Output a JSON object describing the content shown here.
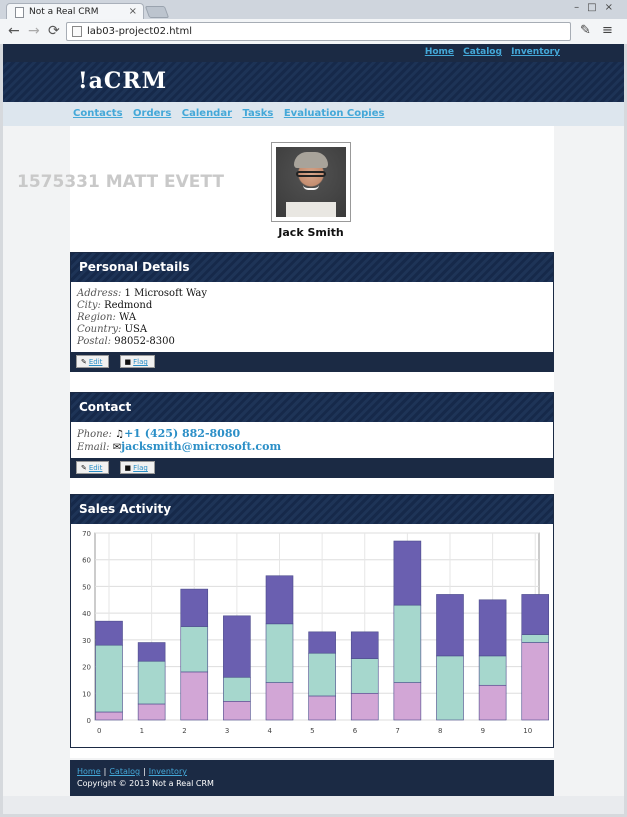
{
  "browser": {
    "tab_title": "Not a Real CRM",
    "tab_close": "×",
    "url": "lab03-project02.html",
    "back_glyph": "←",
    "forward_glyph": "→",
    "reload_glyph": "⟳",
    "window_controls": "–□×",
    "tools_glyph": "≡",
    "wrench_glyph": "✎"
  },
  "header": {
    "top_links": [
      "Home",
      "Catalog",
      "Inventory"
    ],
    "logo": "!aCRM",
    "nav": [
      "Contacts",
      "Orders",
      "Calendar",
      "Tasks",
      "Evaluation Copies"
    ]
  },
  "watermark": "1575331 MATT EVETT",
  "contact": {
    "name": "Jack Smith"
  },
  "personal": {
    "title": "Personal Details",
    "rows": [
      {
        "label": "Address:",
        "value": "1 Microsoft Way"
      },
      {
        "label": "City:",
        "value": "Redmond"
      },
      {
        "label": "Region:",
        "value": "WA"
      },
      {
        "label": "Country:",
        "value": "USA"
      },
      {
        "label": "Postal:",
        "value": "98052-8300"
      }
    ],
    "edit_label": "Edit",
    "flag_label": "Flag"
  },
  "contact_panel": {
    "title": "Contact",
    "phone_label": "Phone:",
    "phone": "+1 (425) 882-8080",
    "email_label": "Email:",
    "email": "jacksmith@microsoft.com",
    "edit_label": "Edit",
    "flag_label": "Flag"
  },
  "sales": {
    "title": "Sales Activity"
  },
  "chart_data": {
    "type": "bar",
    "stacked": true,
    "categories": [
      "0",
      "1",
      "2",
      "3",
      "4",
      "5",
      "6",
      "7",
      "8",
      "9",
      "10"
    ],
    "series": [
      {
        "color": "#d2a6d6",
        "values": [
          3,
          6,
          18,
          7,
          14,
          9,
          10,
          14,
          0,
          13,
          29
        ]
      },
      {
        "color": "#a6d7cd",
        "values": [
          25,
          16,
          17,
          9,
          22,
          16,
          13,
          29,
          24,
          11,
          3
        ]
      },
      {
        "color": "#6a5fb0",
        "values": [
          9,
          7,
          14,
          23,
          18,
          8,
          10,
          24,
          23,
          21,
          15
        ]
      }
    ],
    "xlim": [
      0,
      10
    ],
    "ylim": [
      0,
      70
    ],
    "yticks": [
      "0",
      "10",
      "20",
      "30",
      "40",
      "50",
      "60",
      "70"
    ],
    "grid": true
  },
  "footer": {
    "links": [
      "Home",
      "Catalog",
      "Inventory"
    ],
    "separator": "|",
    "copyright": "Copyright © 2013 Not a Real CRM"
  }
}
